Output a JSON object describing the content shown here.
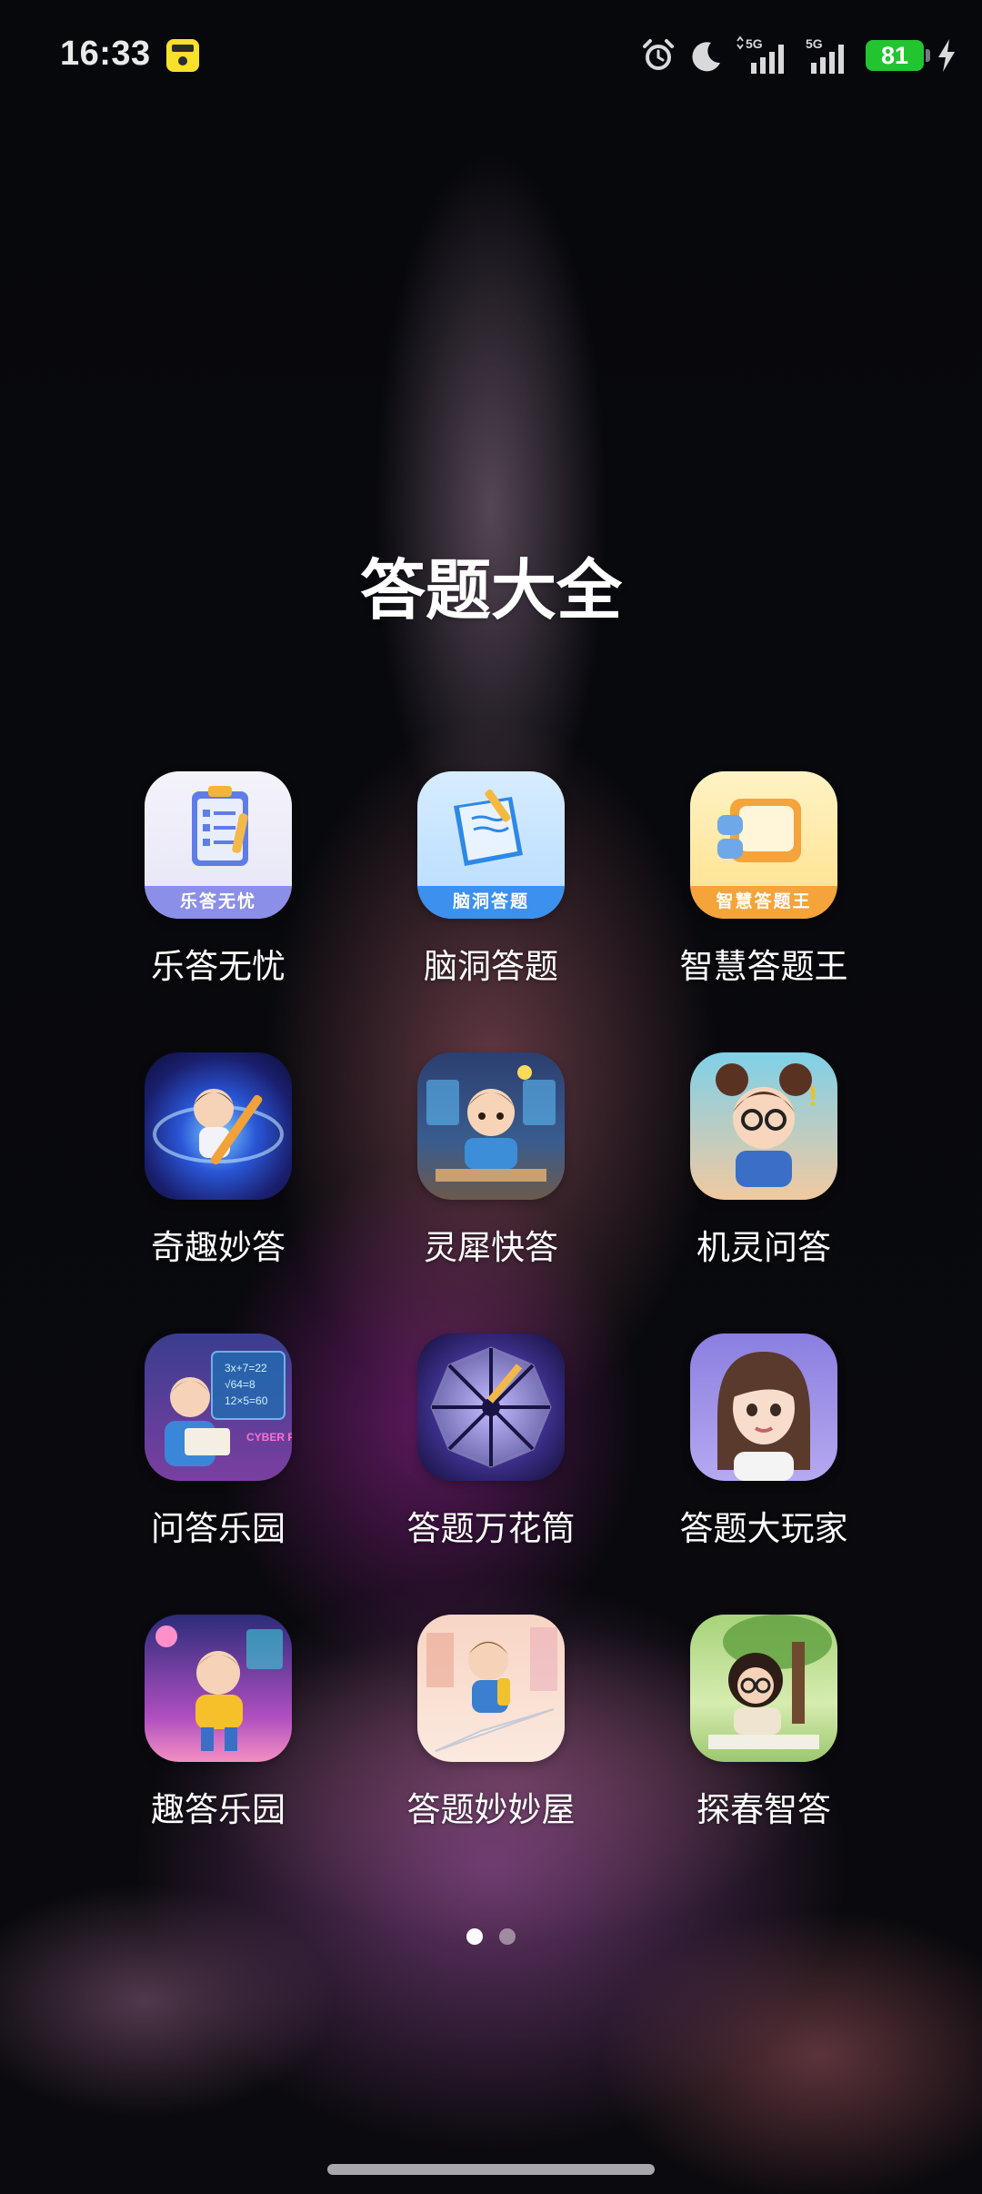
{
  "status_bar": {
    "time": "16:33",
    "battery": "81",
    "signal_1": "5G",
    "signal_2": "5G"
  },
  "folder": {
    "title": "答题大全"
  },
  "apps": [
    {
      "label": "乐答无忧",
      "band_text": "乐答无忧"
    },
    {
      "label": "脑洞答题",
      "band_text": "脑洞答题"
    },
    {
      "label": "智慧答题王",
      "band_text": "智慧答题王"
    },
    {
      "label": "奇趣妙答"
    },
    {
      "label": "灵犀快答"
    },
    {
      "label": "机灵问答"
    },
    {
      "label": "问答乐园",
      "art_text": "3x+7=22",
      "art_text2": "√64=8",
      "art_text3": "12×5=60",
      "art_text4": "CYBER FUN"
    },
    {
      "label": "答题万花筒"
    },
    {
      "label": "答题大玩家"
    },
    {
      "label": "趣答乐园"
    },
    {
      "label": "答题妙妙屋"
    },
    {
      "label": "探春智答"
    }
  ],
  "pager": {
    "total": 2,
    "current": 1
  },
  "colors": {
    "accent_battery": "#22c52f",
    "text": "#ffffff"
  }
}
